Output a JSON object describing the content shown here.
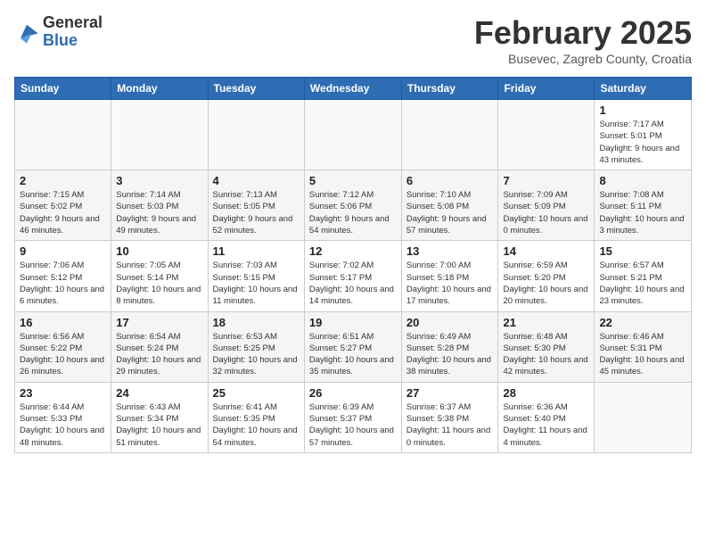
{
  "header": {
    "logo_general": "General",
    "logo_blue": "Blue",
    "month_title": "February 2025",
    "location": "Busevec, Zagreb County, Croatia"
  },
  "weekdays": [
    "Sunday",
    "Monday",
    "Tuesday",
    "Wednesday",
    "Thursday",
    "Friday",
    "Saturday"
  ],
  "weeks": [
    [
      {
        "day": "",
        "info": ""
      },
      {
        "day": "",
        "info": ""
      },
      {
        "day": "",
        "info": ""
      },
      {
        "day": "",
        "info": ""
      },
      {
        "day": "",
        "info": ""
      },
      {
        "day": "",
        "info": ""
      },
      {
        "day": "1",
        "info": "Sunrise: 7:17 AM\nSunset: 5:01 PM\nDaylight: 9 hours and 43 minutes."
      }
    ],
    [
      {
        "day": "2",
        "info": "Sunrise: 7:15 AM\nSunset: 5:02 PM\nDaylight: 9 hours and 46 minutes."
      },
      {
        "day": "3",
        "info": "Sunrise: 7:14 AM\nSunset: 5:03 PM\nDaylight: 9 hours and 49 minutes."
      },
      {
        "day": "4",
        "info": "Sunrise: 7:13 AM\nSunset: 5:05 PM\nDaylight: 9 hours and 52 minutes."
      },
      {
        "day": "5",
        "info": "Sunrise: 7:12 AM\nSunset: 5:06 PM\nDaylight: 9 hours and 54 minutes."
      },
      {
        "day": "6",
        "info": "Sunrise: 7:10 AM\nSunset: 5:08 PM\nDaylight: 9 hours and 57 minutes."
      },
      {
        "day": "7",
        "info": "Sunrise: 7:09 AM\nSunset: 5:09 PM\nDaylight: 10 hours and 0 minutes."
      },
      {
        "day": "8",
        "info": "Sunrise: 7:08 AM\nSunset: 5:11 PM\nDaylight: 10 hours and 3 minutes."
      }
    ],
    [
      {
        "day": "9",
        "info": "Sunrise: 7:06 AM\nSunset: 5:12 PM\nDaylight: 10 hours and 6 minutes."
      },
      {
        "day": "10",
        "info": "Sunrise: 7:05 AM\nSunset: 5:14 PM\nDaylight: 10 hours and 8 minutes."
      },
      {
        "day": "11",
        "info": "Sunrise: 7:03 AM\nSunset: 5:15 PM\nDaylight: 10 hours and 11 minutes."
      },
      {
        "day": "12",
        "info": "Sunrise: 7:02 AM\nSunset: 5:17 PM\nDaylight: 10 hours and 14 minutes."
      },
      {
        "day": "13",
        "info": "Sunrise: 7:00 AM\nSunset: 5:18 PM\nDaylight: 10 hours and 17 minutes."
      },
      {
        "day": "14",
        "info": "Sunrise: 6:59 AM\nSunset: 5:20 PM\nDaylight: 10 hours and 20 minutes."
      },
      {
        "day": "15",
        "info": "Sunrise: 6:57 AM\nSunset: 5:21 PM\nDaylight: 10 hours and 23 minutes."
      }
    ],
    [
      {
        "day": "16",
        "info": "Sunrise: 6:56 AM\nSunset: 5:22 PM\nDaylight: 10 hours and 26 minutes."
      },
      {
        "day": "17",
        "info": "Sunrise: 6:54 AM\nSunset: 5:24 PM\nDaylight: 10 hours and 29 minutes."
      },
      {
        "day": "18",
        "info": "Sunrise: 6:53 AM\nSunset: 5:25 PM\nDaylight: 10 hours and 32 minutes."
      },
      {
        "day": "19",
        "info": "Sunrise: 6:51 AM\nSunset: 5:27 PM\nDaylight: 10 hours and 35 minutes."
      },
      {
        "day": "20",
        "info": "Sunrise: 6:49 AM\nSunset: 5:28 PM\nDaylight: 10 hours and 38 minutes."
      },
      {
        "day": "21",
        "info": "Sunrise: 6:48 AM\nSunset: 5:30 PM\nDaylight: 10 hours and 42 minutes."
      },
      {
        "day": "22",
        "info": "Sunrise: 6:46 AM\nSunset: 5:31 PM\nDaylight: 10 hours and 45 minutes."
      }
    ],
    [
      {
        "day": "23",
        "info": "Sunrise: 6:44 AM\nSunset: 5:33 PM\nDaylight: 10 hours and 48 minutes."
      },
      {
        "day": "24",
        "info": "Sunrise: 6:43 AM\nSunset: 5:34 PM\nDaylight: 10 hours and 51 minutes."
      },
      {
        "day": "25",
        "info": "Sunrise: 6:41 AM\nSunset: 5:35 PM\nDaylight: 10 hours and 54 minutes."
      },
      {
        "day": "26",
        "info": "Sunrise: 6:39 AM\nSunset: 5:37 PM\nDaylight: 10 hours and 57 minutes."
      },
      {
        "day": "27",
        "info": "Sunrise: 6:37 AM\nSunset: 5:38 PM\nDaylight: 11 hours and 0 minutes."
      },
      {
        "day": "28",
        "info": "Sunrise: 6:36 AM\nSunset: 5:40 PM\nDaylight: 11 hours and 4 minutes."
      },
      {
        "day": "",
        "info": ""
      }
    ]
  ]
}
